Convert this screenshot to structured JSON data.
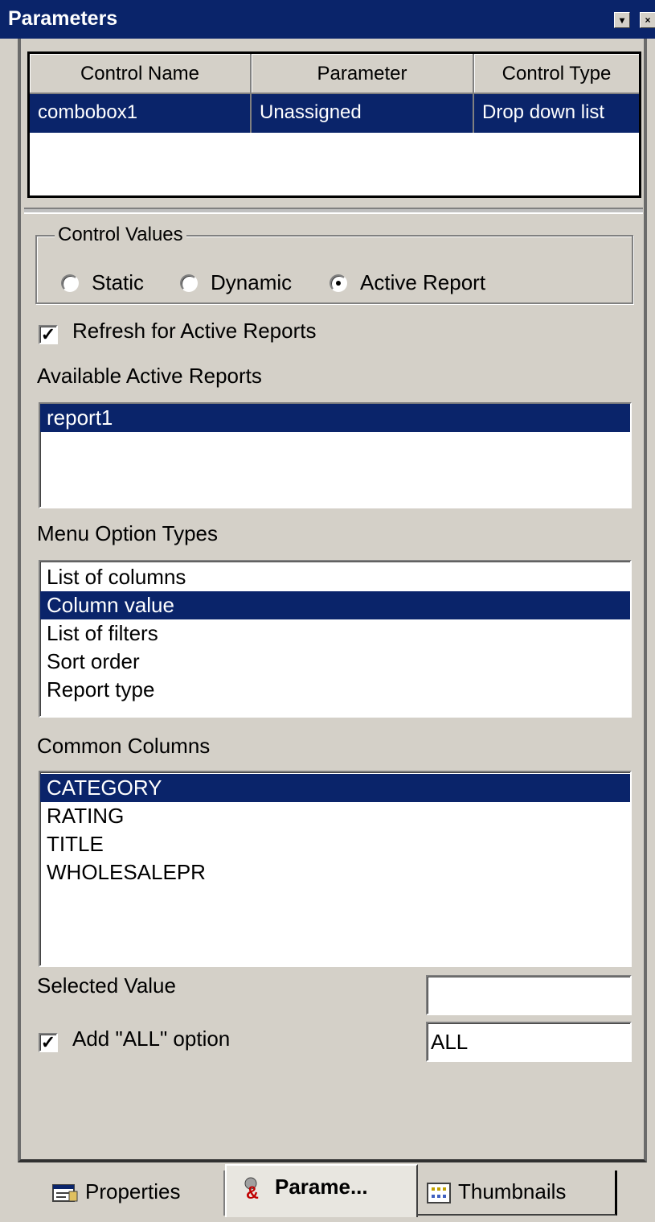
{
  "window": {
    "title": "Parameters"
  },
  "grid": {
    "headers": [
      "Control Name",
      "Parameter",
      "Control Type"
    ],
    "rows": [
      [
        "combobox1",
        "Unassigned",
        "Drop down list"
      ]
    ]
  },
  "control_values": {
    "legend": "Control Values",
    "options": [
      "Static",
      "Dynamic",
      "Active Report"
    ],
    "selected": "Active Report"
  },
  "refresh": {
    "label": "Refresh for Active Reports",
    "checked": true
  },
  "available_reports": {
    "label": "Available Active Reports",
    "items": [
      "report1"
    ],
    "selected": "report1"
  },
  "menu_option_types": {
    "label": "Menu Option Types",
    "items": [
      "List of columns",
      "Column value",
      "List of filters",
      "Sort order",
      "Report type"
    ],
    "selected": "Column value"
  },
  "common_columns": {
    "label": "Common Columns",
    "items": [
      "CATEGORY",
      "RATING",
      "TITLE",
      "WHOLESALEPR"
    ],
    "selected": "CATEGORY"
  },
  "selected_value": {
    "label": "Selected Value",
    "value": ""
  },
  "add_all": {
    "label": "Add \"ALL\" option",
    "checked": true,
    "value": "ALL"
  },
  "tabs": [
    {
      "label": "Properties",
      "icon": "properties-icon"
    },
    {
      "label": "Parame...",
      "icon": "parameters-icon",
      "active": true
    },
    {
      "label": "Thumbnails",
      "icon": "thumbnails-icon"
    }
  ],
  "colors": {
    "title_bar": "#0a246a",
    "selection": "#0a246a",
    "face": "#d4d0c8"
  }
}
